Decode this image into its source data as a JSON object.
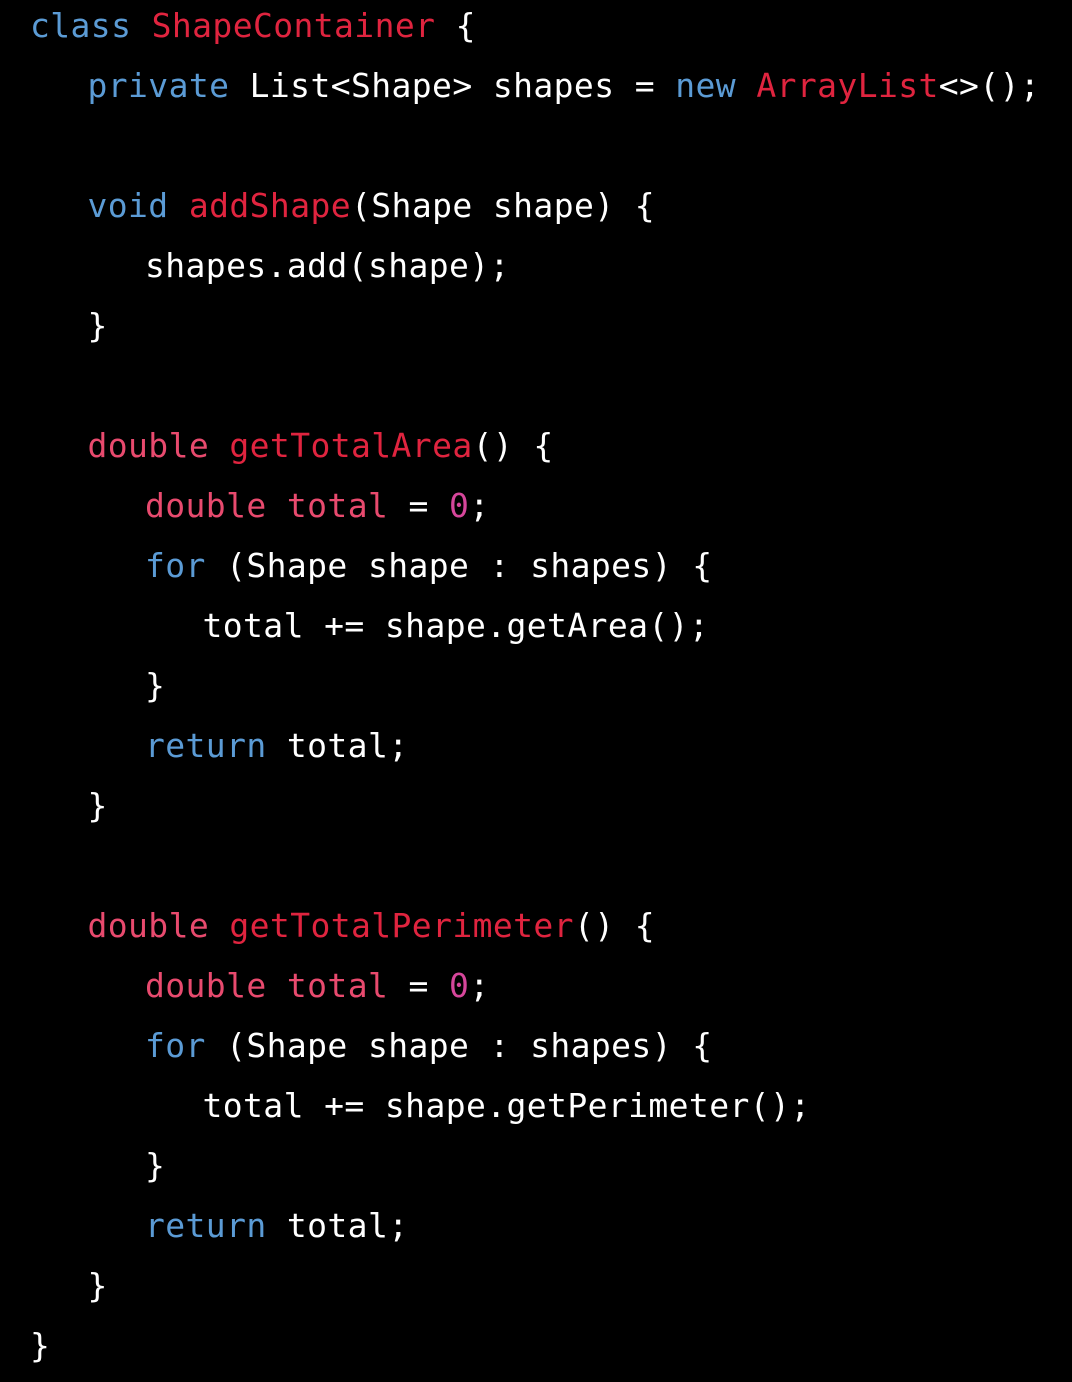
{
  "colors": {
    "background": "#000000",
    "plain": "#ffffff",
    "keyword": "#5b9bd5",
    "type": "#e84a6e",
    "name": "#e0243f",
    "number": "#d6469b"
  },
  "code": {
    "language": "java",
    "lines": [
      {
        "indent": 0,
        "tokens": [
          {
            "t": "class",
            "k": "keyword"
          },
          {
            "t": " ",
            "k": "plain"
          },
          {
            "t": "ShapeContainer",
            "k": "name"
          },
          {
            "t": " {",
            "k": "plain"
          }
        ]
      },
      {
        "indent": 1,
        "tokens": [
          {
            "t": "private",
            "k": "keyword"
          },
          {
            "t": " List<Shape> shapes = ",
            "k": "plain"
          },
          {
            "t": "new",
            "k": "keyword"
          },
          {
            "t": " ",
            "k": "plain"
          },
          {
            "t": "ArrayList",
            "k": "name"
          },
          {
            "t": "<>();",
            "k": "plain"
          }
        ]
      },
      {
        "indent": 0,
        "tokens": []
      },
      {
        "indent": 1,
        "tokens": [
          {
            "t": "void",
            "k": "keyword"
          },
          {
            "t": " ",
            "k": "plain"
          },
          {
            "t": "addShape",
            "k": "name"
          },
          {
            "t": "(Shape shape) {",
            "k": "plain"
          }
        ]
      },
      {
        "indent": 2,
        "tokens": [
          {
            "t": "shapes.add(shape);",
            "k": "plain"
          }
        ]
      },
      {
        "indent": 1,
        "tokens": [
          {
            "t": "}",
            "k": "plain"
          }
        ]
      },
      {
        "indent": 0,
        "tokens": []
      },
      {
        "indent": 1,
        "tokens": [
          {
            "t": "double",
            "k": "type"
          },
          {
            "t": " ",
            "k": "plain"
          },
          {
            "t": "getTotalArea",
            "k": "name"
          },
          {
            "t": "() {",
            "k": "plain"
          }
        ]
      },
      {
        "indent": 2,
        "tokens": [
          {
            "t": "double",
            "k": "type"
          },
          {
            "t": " ",
            "k": "plain"
          },
          {
            "t": "total",
            "k": "type"
          },
          {
            "t": " = ",
            "k": "plain"
          },
          {
            "t": "0",
            "k": "number"
          },
          {
            "t": ";",
            "k": "plain"
          }
        ]
      },
      {
        "indent": 2,
        "tokens": [
          {
            "t": "for",
            "k": "keyword"
          },
          {
            "t": " (Shape shape : shapes) {",
            "k": "plain"
          }
        ]
      },
      {
        "indent": 3,
        "tokens": [
          {
            "t": "total += shape.getArea();",
            "k": "plain"
          }
        ]
      },
      {
        "indent": 2,
        "tokens": [
          {
            "t": "}",
            "k": "plain"
          }
        ]
      },
      {
        "indent": 2,
        "tokens": [
          {
            "t": "return",
            "k": "keyword"
          },
          {
            "t": " total;",
            "k": "plain"
          }
        ]
      },
      {
        "indent": 1,
        "tokens": [
          {
            "t": "}",
            "k": "plain"
          }
        ]
      },
      {
        "indent": 0,
        "tokens": []
      },
      {
        "indent": 1,
        "tokens": [
          {
            "t": "double",
            "k": "type"
          },
          {
            "t": " ",
            "k": "plain"
          },
          {
            "t": "getTotalPerimeter",
            "k": "name"
          },
          {
            "t": "() {",
            "k": "plain"
          }
        ]
      },
      {
        "indent": 2,
        "tokens": [
          {
            "t": "double",
            "k": "type"
          },
          {
            "t": " ",
            "k": "plain"
          },
          {
            "t": "total",
            "k": "type"
          },
          {
            "t": " = ",
            "k": "plain"
          },
          {
            "t": "0",
            "k": "number"
          },
          {
            "t": ";",
            "k": "plain"
          }
        ]
      },
      {
        "indent": 2,
        "tokens": [
          {
            "t": "for",
            "k": "keyword"
          },
          {
            "t": " (Shape shape : shapes) {",
            "k": "plain"
          }
        ]
      },
      {
        "indent": 3,
        "tokens": [
          {
            "t": "total += shape.getPerimeter();",
            "k": "plain"
          }
        ]
      },
      {
        "indent": 2,
        "tokens": [
          {
            "t": "}",
            "k": "plain"
          }
        ]
      },
      {
        "indent": 2,
        "tokens": [
          {
            "t": "return",
            "k": "keyword"
          },
          {
            "t": " total;",
            "k": "plain"
          }
        ]
      },
      {
        "indent": 1,
        "tokens": [
          {
            "t": "}",
            "k": "plain"
          }
        ]
      },
      {
        "indent": 0,
        "tokens": [
          {
            "t": "}",
            "k": "plain"
          }
        ]
      }
    ]
  }
}
